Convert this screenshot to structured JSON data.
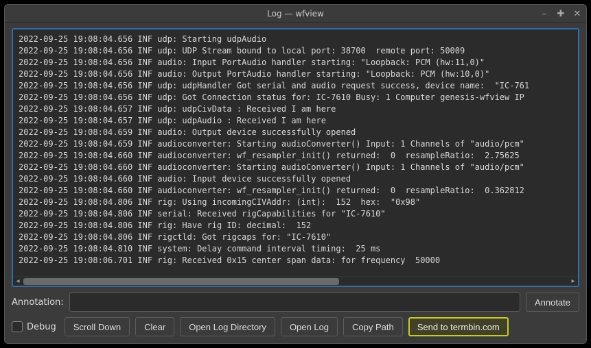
{
  "title": "Log — wfview",
  "log_lines": [
    "2022-09-25 19:08:04.656 INF udp: Starting udpAudio",
    "2022-09-25 19:08:04.656 INF udp: UDP Stream bound to local port: 38700  remote port: 50009",
    "2022-09-25 19:08:04.656 INF audio: Input PortAudio handler starting: \"Loopback: PCM (hw:11,0)\"",
    "2022-09-25 19:08:04.656 INF audio: Output PortAudio handler starting: \"Loopback: PCM (hw:10,0)\"",
    "2022-09-25 19:08:04.656 INF udp: udpHandler Got serial and audio request success, device name:  \"IC-761",
    "2022-09-25 19:08:04.656 INF udp: Got Connection status for: IC-7610 Busy: 1 Computer genesis-wfview IP",
    "2022-09-25 19:08:04.657 INF udp: udpCivData : Received I am here",
    "2022-09-25 19:08:04.657 INF udp: udpAudio : Received I am here",
    "2022-09-25 19:08:04.659 INF audio: Output device successfully opened",
    "2022-09-25 19:08:04.659 INF audioconverter: Starting audioConverter() Input: 1 Channels of \"audio/pcm\"",
    "2022-09-25 19:08:04.660 INF audioconverter: wf_resampler_init() returned:  0  resampleRatio:  2.75625",
    "2022-09-25 19:08:04.660 INF audioconverter: Starting audioConverter() Input: 1 Channels of \"audio/pcm\"",
    "2022-09-25 19:08:04.660 INF audio: Input device successfully opened",
    "2022-09-25 19:08:04.660 INF audioconverter: wf_resampler_init() returned:  0  resampleRatio:  0.362812",
    "2022-09-25 19:08:04.806 INF rig: Using incomingCIVAddr: (int):  152  hex:  \"0x98\"",
    "2022-09-25 19:08:04.806 INF serial: Received rigCapabilities for \"IC-7610\"",
    "2022-09-25 19:08:04.806 INF rig: Have rig ID: decimal:  152",
    "2022-09-25 19:08:04.806 INF rigctld: Got rigcaps for: \"IC-7610\"",
    "2022-09-25 19:08:04.810 INF system: Delay command interval timing:  25 ms",
    "2022-09-25 19:08:06.701 INF rig: Received 0x15 center span data: for frequency  50000"
  ],
  "annotation": {
    "label": "Annotation:",
    "value": "",
    "button": "Annotate"
  },
  "debug_label": "Debug",
  "buttons": {
    "scroll_down": "Scroll Down",
    "clear": "Clear",
    "open_dir": "Open Log Directory",
    "open_log": "Open Log",
    "copy_path": "Copy Path",
    "send_termbin": "Send to termbin.com"
  }
}
